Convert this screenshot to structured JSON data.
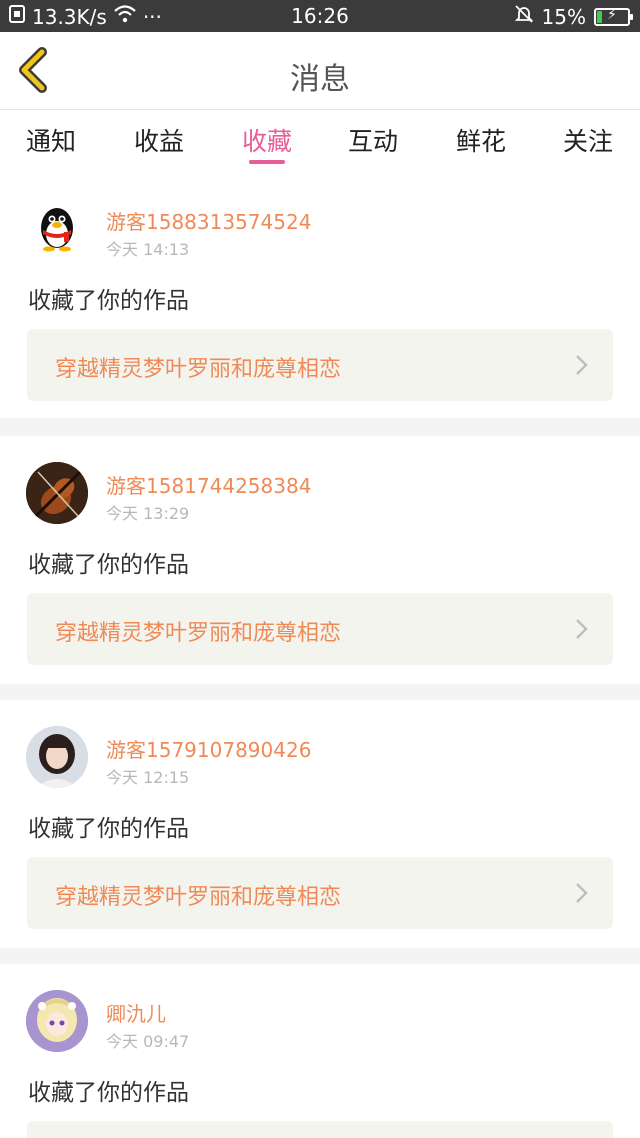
{
  "status_bar": {
    "speed": "13.3K/s",
    "dots": "···",
    "time": "16:26",
    "battery": "15%",
    "battery_level": 0.15,
    "icons": [
      "sim-icon",
      "wifi-icon",
      "mute-bell-icon",
      "battery-icon"
    ]
  },
  "header": {
    "title": "消息",
    "back_icon": "chevron-left-icon",
    "accent_color": "#f2b200"
  },
  "tabs": [
    {
      "label": "通知",
      "active": false
    },
    {
      "label": "收益",
      "active": false
    },
    {
      "label": "收藏",
      "active": true
    },
    {
      "label": "互动",
      "active": false
    },
    {
      "label": "鲜花",
      "active": false
    },
    {
      "label": "关注",
      "active": false
    }
  ],
  "colors": {
    "active_tab": "#e75f98",
    "username": "#ef8a56",
    "work_title": "#ef8a56"
  },
  "messages": [
    {
      "username": "游客1588313574524",
      "time": "今天 14:13",
      "action": "收藏了你的作品",
      "work_title": "穿越精灵梦叶罗丽和庞尊相恋",
      "avatar": "penguin-avatar"
    },
    {
      "username": "游客1581744258384",
      "time": "今天 13:29",
      "action": "收藏了你的作品",
      "work_title": "穿越精灵梦叶罗丽和庞尊相恋",
      "avatar": "violin-avatar"
    },
    {
      "username": "游客1579107890426",
      "time": "今天 12:15",
      "action": "收藏了你的作品",
      "work_title": "穿越精灵梦叶罗丽和庞尊相恋",
      "avatar": "girl-photo-avatar"
    },
    {
      "username": "卿氿儿",
      "time": "今天 09:47",
      "action": "收藏了你的作品",
      "work_title": "",
      "avatar": "anime-girl-avatar"
    }
  ]
}
